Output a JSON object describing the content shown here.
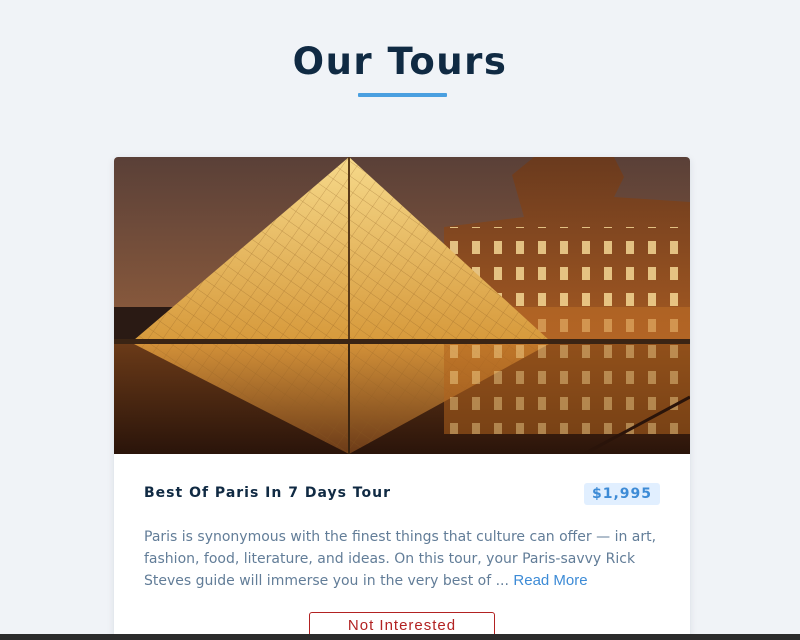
{
  "page": {
    "title": "Our Tours",
    "accent_color": "#4a9fe0"
  },
  "tour": {
    "name": "Best Of Paris In 7 Days Tour",
    "price": "$1,995",
    "image": "louvre-pyramid-night-photo",
    "description": "Paris is synonymous with the finest things that culture can offer — in art, fashion, food, literature, and ideas. On this tour, your Paris-savvy Rick Steves guide will immerse you in the very best of ...",
    "read_more_label": "Read More",
    "not_interested_label": "Not Interested",
    "danger_color": "#b22222"
  }
}
